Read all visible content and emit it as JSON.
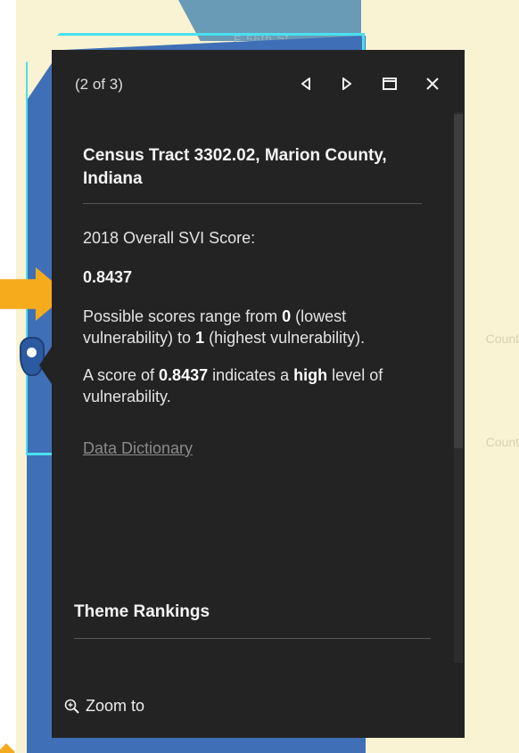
{
  "map": {
    "street_label": "E 56th St",
    "county_labels": [
      "Count",
      "Count"
    ]
  },
  "popup": {
    "counter": "(2 of 3)",
    "title": "Census Tract 3302.02, Marion County, Indiana",
    "score_heading": "2018 Overall SVI Score:",
    "score_value": "0.8437",
    "range_text": {
      "part1": "Possible scores range from ",
      "min": "0",
      "part2": " (lowest vulnerability) to ",
      "max": "1",
      "part3": " (highest vulnerability)."
    },
    "indicator_text": {
      "part1": "A score of ",
      "score": "0.8437",
      "part2": " indicates a ",
      "level": "high",
      "part3": " level of vulnerability."
    },
    "link_label": "Data Dictionary",
    "theme_heading": "Theme Rankings",
    "zoom_label": "Zoom to",
    "icons": {
      "previous": "previous-arrow-icon",
      "next": "next-arrow-icon",
      "dock": "dock-window-icon",
      "close": "close-icon",
      "zoom": "zoom-in-icon"
    }
  },
  "colors": {
    "popup_bg": "#232323",
    "tract_fill": "#3f6fb7",
    "tract_outline": "#49e0f0",
    "annotation_arrow": "#f6ab1c",
    "map_bg": "#f9f3d3"
  }
}
